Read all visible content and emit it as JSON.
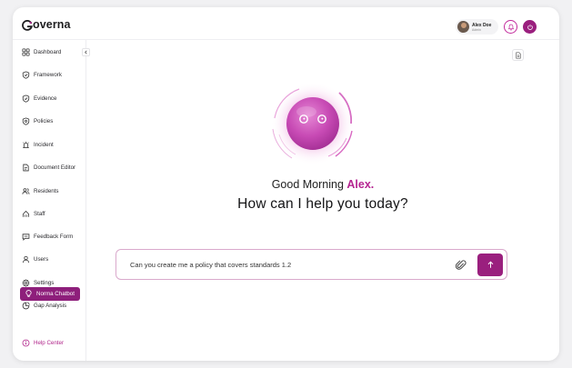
{
  "app": {
    "logo_text": "overna"
  },
  "header": {
    "user_name": "Alex Doe",
    "user_role": "Admin"
  },
  "sidebar": {
    "items": [
      {
        "label": "Dashboard",
        "icon": "grid-icon"
      },
      {
        "label": "Framework",
        "icon": "framework-icon"
      },
      {
        "label": "Evidence",
        "icon": "shield-check-icon"
      },
      {
        "label": "Policies",
        "icon": "shield-icon"
      },
      {
        "label": "Incident",
        "icon": "alarm-icon"
      },
      {
        "label": "Document Editor",
        "icon": "document-edit-icon"
      },
      {
        "label": "Residents",
        "icon": "users-icon"
      },
      {
        "label": "Staff",
        "icon": "staff-icon"
      },
      {
        "label": "Feedback Form",
        "icon": "feedback-icon"
      },
      {
        "label": "Users",
        "icon": "user-icon"
      },
      {
        "label": "Settings",
        "icon": "gear-icon"
      },
      {
        "label": "Gap Analysis",
        "icon": "gap-analysis-icon"
      }
    ],
    "active_item": {
      "label": "Norma Chatbot",
      "icon": "bulb-icon"
    },
    "help": {
      "label": "Help Center",
      "icon": "help-icon"
    }
  },
  "main": {
    "greeting_prefix": "Good Morning ",
    "greeting_name": "Alex.",
    "question": "How can I help you today?",
    "input_value": "Can you create me a policy that covers standards 1.2"
  },
  "colors": {
    "brand": "#9a1f7e",
    "accent": "#b52591",
    "orb": "#c84bb5"
  }
}
